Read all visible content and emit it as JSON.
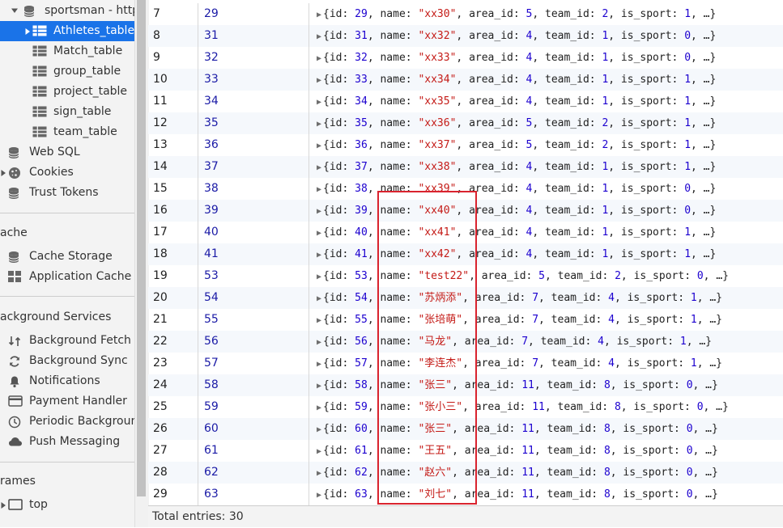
{
  "sidebar": {
    "db_name": "sportsman - http:",
    "tables": [
      "Athletes_table",
      "Match_table",
      "group_table",
      "project_table",
      "sign_table",
      "team_table"
    ],
    "selected_table": "Athletes_table",
    "storage_items": [
      "Web SQL",
      "Cookies",
      "Trust Tokens"
    ],
    "cache_header": "ache",
    "cache_items": [
      "Cache Storage",
      "Application Cache"
    ],
    "bg_header": "ackground Services",
    "bg_items": [
      "Background Fetch",
      "Background Sync",
      "Notifications",
      "Payment Handler",
      "Periodic Backgroun",
      "Push Messaging"
    ],
    "frames_header": "rames",
    "frames_items": [
      "top"
    ]
  },
  "rows": [
    {
      "idx": "7",
      "key": "29",
      "id": "29",
      "name": "\"xx30\"",
      "area_id": "5",
      "team_id": "2",
      "is_sport": "1"
    },
    {
      "idx": "8",
      "key": "31",
      "id": "31",
      "name": "\"xx32\"",
      "area_id": "4",
      "team_id": "1",
      "is_sport": "0"
    },
    {
      "idx": "9",
      "key": "32",
      "id": "32",
      "name": "\"xx33\"",
      "area_id": "4",
      "team_id": "1",
      "is_sport": "0"
    },
    {
      "idx": "10",
      "key": "33",
      "id": "33",
      "name": "\"xx34\"",
      "area_id": "4",
      "team_id": "1",
      "is_sport": "1"
    },
    {
      "idx": "11",
      "key": "34",
      "id": "34",
      "name": "\"xx35\"",
      "area_id": "4",
      "team_id": "1",
      "is_sport": "1"
    },
    {
      "idx": "12",
      "key": "35",
      "id": "35",
      "name": "\"xx36\"",
      "area_id": "5",
      "team_id": "2",
      "is_sport": "1"
    },
    {
      "idx": "13",
      "key": "36",
      "id": "36",
      "name": "\"xx37\"",
      "area_id": "5",
      "team_id": "2",
      "is_sport": "1"
    },
    {
      "idx": "14",
      "key": "37",
      "id": "37",
      "name": "\"xx38\"",
      "area_id": "4",
      "team_id": "1",
      "is_sport": "1"
    },
    {
      "idx": "15",
      "key": "38",
      "id": "38",
      "name": "\"xx39\"",
      "area_id": "4",
      "team_id": "1",
      "is_sport": "0"
    },
    {
      "idx": "16",
      "key": "39",
      "id": "39",
      "name": "\"xx40\"",
      "area_id": "4",
      "team_id": "1",
      "is_sport": "0"
    },
    {
      "idx": "17",
      "key": "40",
      "id": "40",
      "name": "\"xx41\"",
      "area_id": "4",
      "team_id": "1",
      "is_sport": "1"
    },
    {
      "idx": "18",
      "key": "41",
      "id": "41",
      "name": "\"xx42\"",
      "area_id": "4",
      "team_id": "1",
      "is_sport": "1"
    },
    {
      "idx": "19",
      "key": "53",
      "id": "53",
      "name": "\"test22\"",
      "area_id": "5",
      "team_id": "2",
      "is_sport": "0"
    },
    {
      "idx": "20",
      "key": "54",
      "id": "54",
      "name": "\"苏炳添\"",
      "area_id": "7",
      "team_id": "4",
      "is_sport": "1"
    },
    {
      "idx": "21",
      "key": "55",
      "id": "55",
      "name": "\"张培萌\"",
      "area_id": "7",
      "team_id": "4",
      "is_sport": "1"
    },
    {
      "idx": "22",
      "key": "56",
      "id": "56",
      "name": "\"马龙\"",
      "area_id": "7",
      "team_id": "4",
      "is_sport": "1"
    },
    {
      "idx": "23",
      "key": "57",
      "id": "57",
      "name": "\"李连杰\"",
      "area_id": "7",
      "team_id": "4",
      "is_sport": "1"
    },
    {
      "idx": "24",
      "key": "58",
      "id": "58",
      "name": "\"张三\"",
      "area_id": "11",
      "team_id": "8",
      "is_sport": "0"
    },
    {
      "idx": "25",
      "key": "59",
      "id": "59",
      "name": "\"张小三\"",
      "area_id": "11",
      "team_id": "8",
      "is_sport": "0"
    },
    {
      "idx": "26",
      "key": "60",
      "id": "60",
      "name": "\"张三\"",
      "area_id": "11",
      "team_id": "8",
      "is_sport": "0"
    },
    {
      "idx": "27",
      "key": "61",
      "id": "61",
      "name": "\"王五\"",
      "area_id": "11",
      "team_id": "8",
      "is_sport": "0"
    },
    {
      "idx": "28",
      "key": "62",
      "id": "62",
      "name": "\"赵六\"",
      "area_id": "11",
      "team_id": "8",
      "is_sport": "0"
    },
    {
      "idx": "29",
      "key": "63",
      "id": "63",
      "name": "\"刘七\"",
      "area_id": "11",
      "team_id": "8",
      "is_sport": "0"
    }
  ],
  "footer": {
    "text": "Total entries: 30"
  },
  "colors": {
    "selection": "#1a73e8",
    "highlight_box": "#d9232e",
    "string": "#c41a16",
    "number": "#1c00cf"
  }
}
